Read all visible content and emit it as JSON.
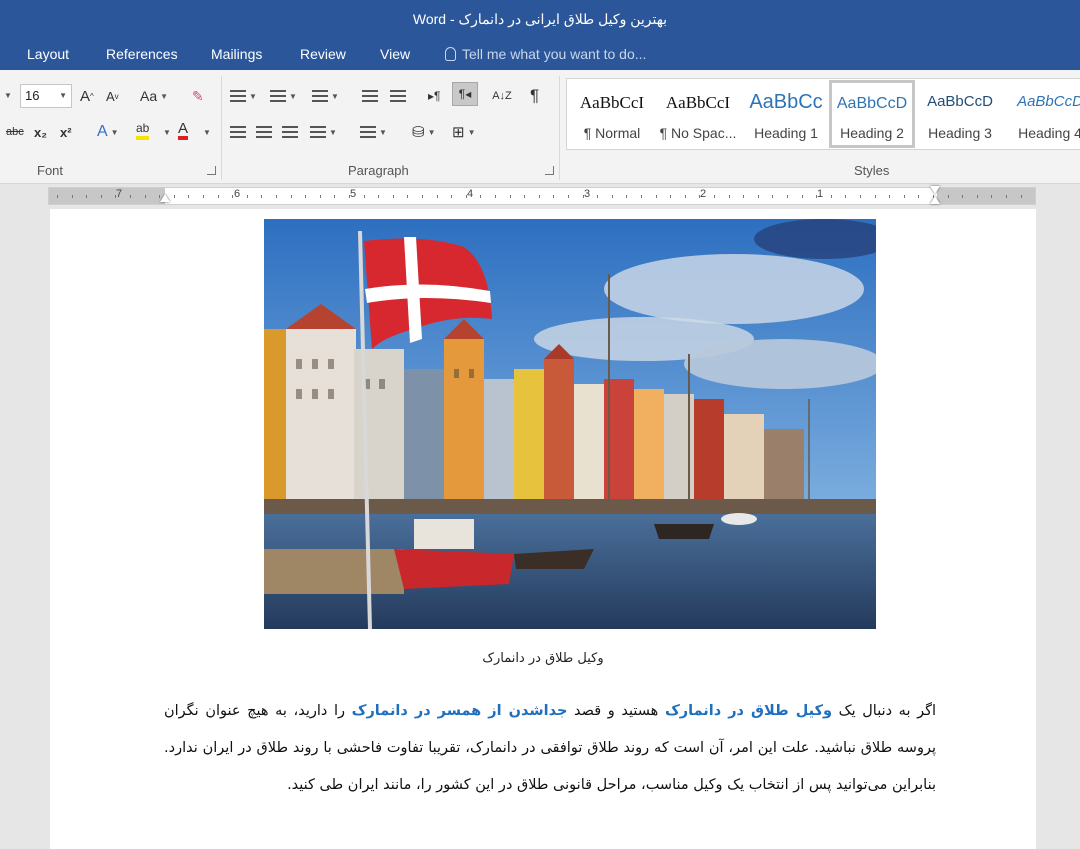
{
  "window": {
    "title": "بهترین وکیل طلاق ایرانی در دانمارک - Word"
  },
  "tabs": [
    "Layout",
    "References",
    "Mailings",
    "Review",
    "View"
  ],
  "tell_me": "Tell me what you want to do...",
  "ribbon": {
    "font": {
      "label": "Font",
      "size": "16",
      "grow": "A",
      "shrink": "A",
      "case": "Aa",
      "strike": "abc",
      "subscript": "x₂",
      "superscript": "x²",
      "text_effects": "A",
      "highlight": "ab",
      "font_color": "A"
    },
    "paragraph": {
      "label": "Paragraph",
      "sort": "A↓Z",
      "show_marks": "¶"
    },
    "styles": {
      "label": "Styles",
      "items": [
        {
          "sample": "AaBbCcI",
          "name": "¶ Normal"
        },
        {
          "sample": "AaBbCcI",
          "name": "¶ No Spac..."
        },
        {
          "sample": "AaBbCc",
          "name": "Heading 1"
        },
        {
          "sample": "AaBbCcD",
          "name": "Heading 2"
        },
        {
          "sample": "AaBbCcD",
          "name": "Heading 3"
        },
        {
          "sample": "AaBbCcD",
          "name": "Heading 4"
        }
      ],
      "selected": "Heading 2"
    }
  },
  "ruler": {
    "numbers": [
      "7",
      "6",
      "5",
      "4",
      "3",
      "2",
      "1"
    ]
  },
  "document": {
    "image_caption": "وکیل طلاق در دانمارک",
    "paragraph": {
      "t1": "اگر به دنبال یک ",
      "link1": "وکیل طلاق در دانمارک",
      "t2": " هستید و قصد ",
      "link2": "جداشدن از همسر در دانمارک",
      "t3": " را دارید، به هیچ عنوان نگران پروسه طلاق نباشید. علت این امر، آن است که روند طلاق توافقی در دانمارک، تقریبا تفاوت فاحشی با روند طلاق در ایران ندارد. بنابراین می‌توانید پس از انتخاب یک وکیل مناسب، مراحل قانونی طلاق در این کشور را، مانند ایران طی کنید."
    }
  },
  "colors": {
    "word_blue": "#2b579a",
    "link_blue": "#1f6fbf",
    "flag_red": "#d7282f"
  }
}
